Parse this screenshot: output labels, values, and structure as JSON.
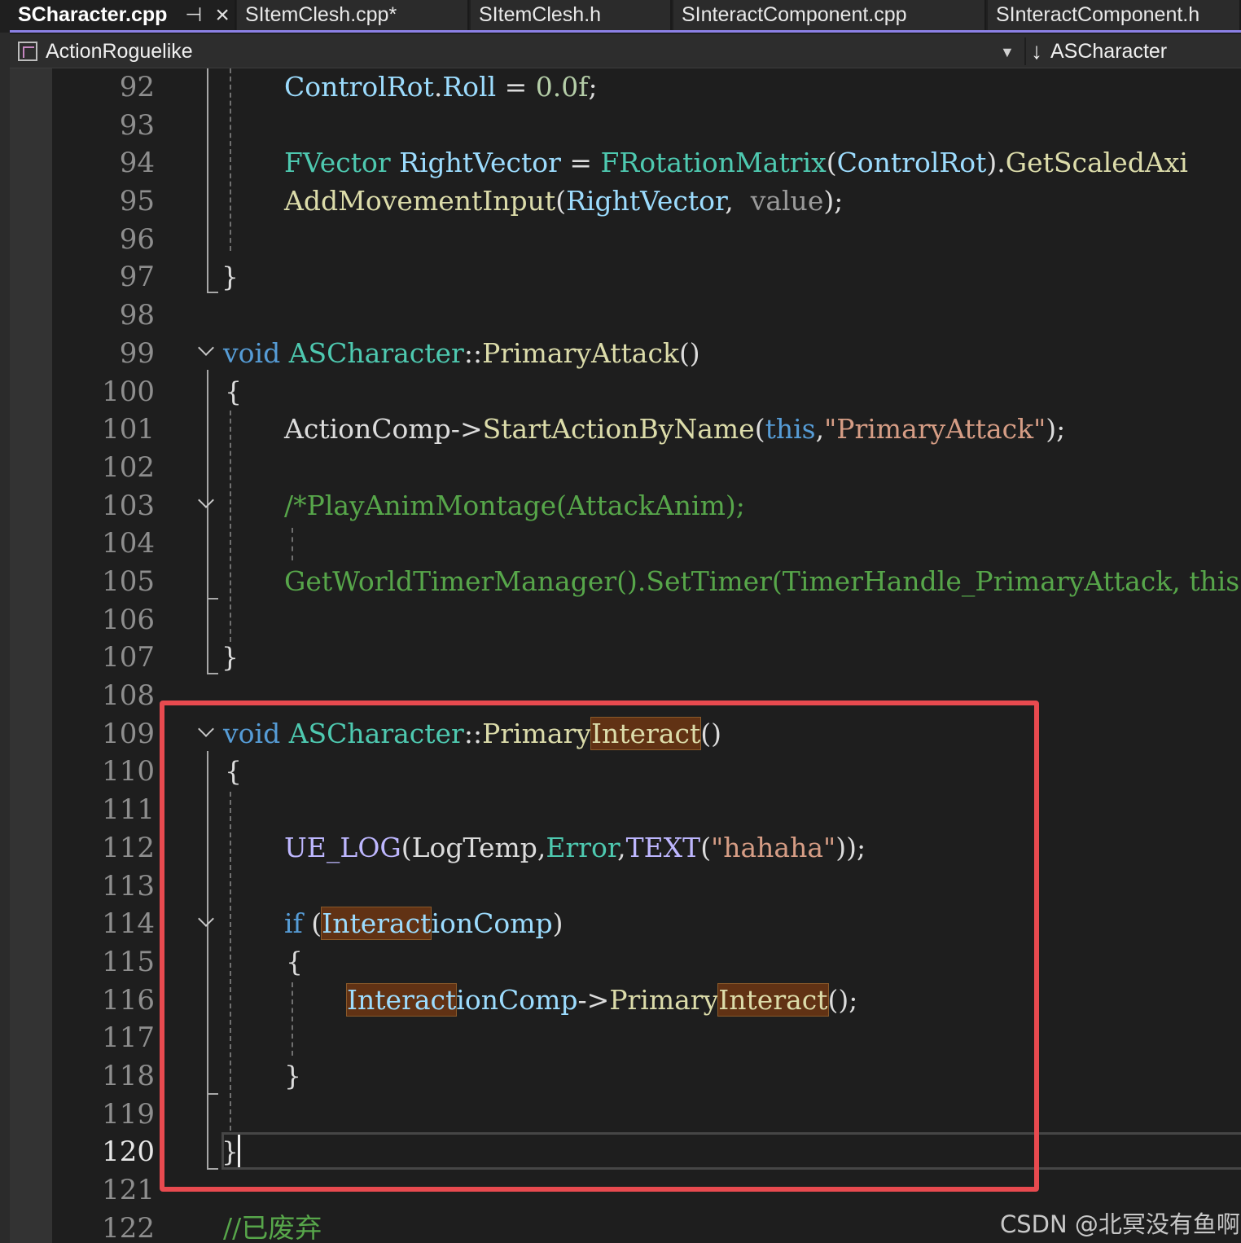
{
  "tabs": [
    {
      "label": "SCharacter.cpp",
      "active": true,
      "pin_icon": "pin-icon",
      "close_icon": "close-icon"
    },
    {
      "label": "SItemClesh.cpp*"
    },
    {
      "label": "SItemClesh.h"
    },
    {
      "label": "SInteractComponent.cpp"
    },
    {
      "label": "SInteractComponent.h"
    }
  ],
  "navbar": {
    "project": "ActionRoguelike",
    "project_icon": "cpp-project-icon",
    "dropdown_icon": "chevron-down-icon",
    "class_icon": "arrow-down-icon",
    "class_name": "ASCharacter"
  },
  "editor": {
    "current_line": 120,
    "line_numbers": [
      "92",
      "93",
      "94",
      "95",
      "96",
      "97",
      "98",
      "99",
      "100",
      "101",
      "102",
      "103",
      "104",
      "105",
      "106",
      "107",
      "108",
      "109",
      "110",
      "111",
      "112",
      "113",
      "114",
      "115",
      "116",
      "117",
      "118",
      "119",
      "120",
      "121",
      "122"
    ],
    "tokens": {
      "l92": {
        "a": "ControlRot",
        "b": ".",
        "c": "Roll",
        "d": " = ",
        "e": "0.0f",
        "f": ";"
      },
      "l94": {
        "a": "FVector",
        "b": " ",
        "c": "RightVector",
        "d": " = ",
        "e": "FRotationMatrix",
        "f": "(",
        "g": "ControlRot",
        "h": ").",
        "i": "GetScaledAxi"
      },
      "l95": {
        "a": "AddMovementInput",
        "b": "(",
        "c": "RightVector",
        "d": ",  ",
        "e": "value",
        "f": ");"
      },
      "l97": {
        "a": "}"
      },
      "l99": {
        "a": "void",
        "b": " ",
        "c": "ASCharacter",
        "d": "::",
        "e": "PrimaryAttack",
        "f": "()"
      },
      "l100": {
        "a": "{"
      },
      "l101": {
        "a": "ActionComp",
        "b": "->",
        "c": "StartActionByName",
        "d": "(",
        "e": "this",
        "f": ",",
        "g": "\"PrimaryAttack\"",
        "h": ");"
      },
      "l103": {
        "a": "/*PlayAnimMontage(AttackAnim);"
      },
      "l105": {
        "a": "GetWorldTimerManager().SetTimer(TimerHandle_PrimaryAttack, this"
      },
      "l107": {
        "a": "}"
      },
      "l109": {
        "a": "void",
        "b": " ",
        "c": "ASCharacter",
        "d": "::",
        "e": "Primary",
        "f": "Interact",
        "g": "()"
      },
      "l110": {
        "a": "{"
      },
      "l112": {
        "a": "UE_LOG",
        "b": "(",
        "c": "LogTemp",
        "d": ",",
        "e": "Error",
        "f": ",",
        "g": "TEXT",
        "h": "(",
        "i": "\"hahaha\"",
        "j": "));"
      },
      "l114": {
        "a": "if",
        "b": " (",
        "c": "Interact",
        "d": "ionComp",
        "e": ")"
      },
      "l115": {
        "a": "{"
      },
      "l116": {
        "a": "Interact",
        "b": "ionComp",
        "c": "->",
        "d": "Primary",
        "e": "Interact",
        "f": "();"
      },
      "l118": {
        "a": "}"
      },
      "l120": {
        "a": "}"
      },
      "l122": {
        "a": "//已废弃"
      }
    }
  },
  "annotation": {
    "color": "#e84a4f"
  },
  "watermark": "CSDN @北冥没有鱼啊",
  "colors": {
    "keyword": "#569cd6",
    "type": "#4ec9b0",
    "function": "#dcdcaa",
    "variable": "#9cdcfe",
    "string": "#d69d85",
    "comment": "#57a64a",
    "find_highlight": "#613214",
    "tab_accent": "#8c81e6"
  }
}
